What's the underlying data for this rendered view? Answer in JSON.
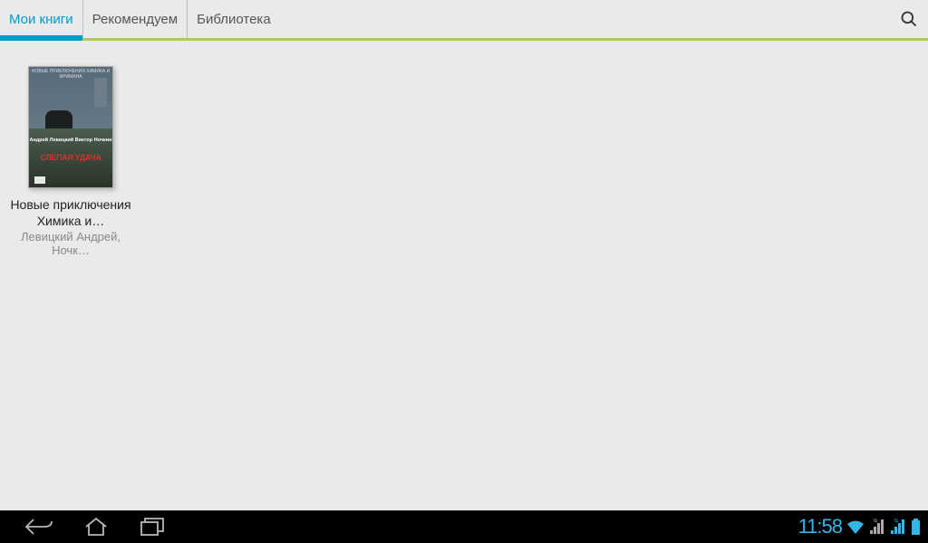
{
  "tabs": [
    {
      "label": "Мои книги",
      "active": true
    },
    {
      "label": "Рекомендуем",
      "active": false
    },
    {
      "label": "Библиотека",
      "active": false
    }
  ],
  "icons": {
    "search": "search"
  },
  "book": {
    "title": "Новые приключения Химика и…",
    "author": "Левицкий Андрей, Ночк…",
    "cover": {
      "top_text": "НОВЫЕ ПРИКЛЮЧЕНИЯ ХИМИКА И ФРИМАНА",
      "author_lines": "Андрей Левицкий\nВиктор Ночкин",
      "cover_title": "СЛЕПАЯ УДАЧА"
    }
  },
  "statusbar": {
    "time": "11:58"
  }
}
